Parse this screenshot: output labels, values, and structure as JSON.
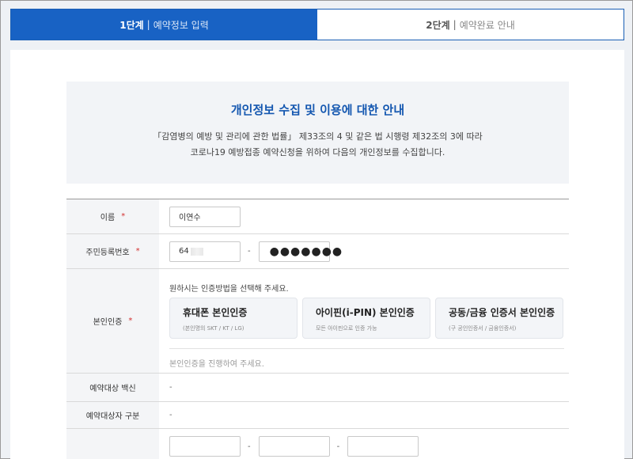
{
  "steps": [
    {
      "num": "1단계",
      "sep": "|",
      "label": "예약정보 입력",
      "active": true
    },
    {
      "num": "2단계",
      "sep": "|",
      "label": "예약완료 안내",
      "active": false
    }
  ],
  "notice": {
    "title": "개인정보 수집 및 이용에 대한 안내",
    "line1": "「감염병의 예방 및 관리에 관한 법률」 제33조의 4 및 같은 법 시행령 제32조의 3에 따라",
    "line2": "코로나19 예방접종 예약신청을 위하여 다음의 개인정보를 수집합니다."
  },
  "form": {
    "name": {
      "label": "이름",
      "required": "*",
      "value": "이연수"
    },
    "rrn": {
      "label": "주민등록번호",
      "required": "*",
      "front_value": "64",
      "dash": "-",
      "back_value": "●●●●●●●"
    },
    "auth": {
      "label": "본인인증",
      "required": "*",
      "guide": "원하시는 인증방법을 선택해 주세요.",
      "options": [
        {
          "title": "휴대폰 본인인증",
          "sub": "(본인명의 SKT / KT / LG)"
        },
        {
          "title": "아이핀(i-PIN) 본인인증",
          "sub": "모든 아이핀으로 인증 가능"
        },
        {
          "title": "공동/금융 인증서 본인인증",
          "sub": "(구 공인인증서 / 금융인증서)"
        }
      ],
      "note": "본인인증을 진행하여 주세요."
    },
    "vaccine": {
      "label": "예약대상 백신",
      "value": "-"
    },
    "category": {
      "label": "예약대상자 구분",
      "value": "-"
    },
    "phone": {
      "dash1": "-",
      "dash2": "-"
    }
  }
}
